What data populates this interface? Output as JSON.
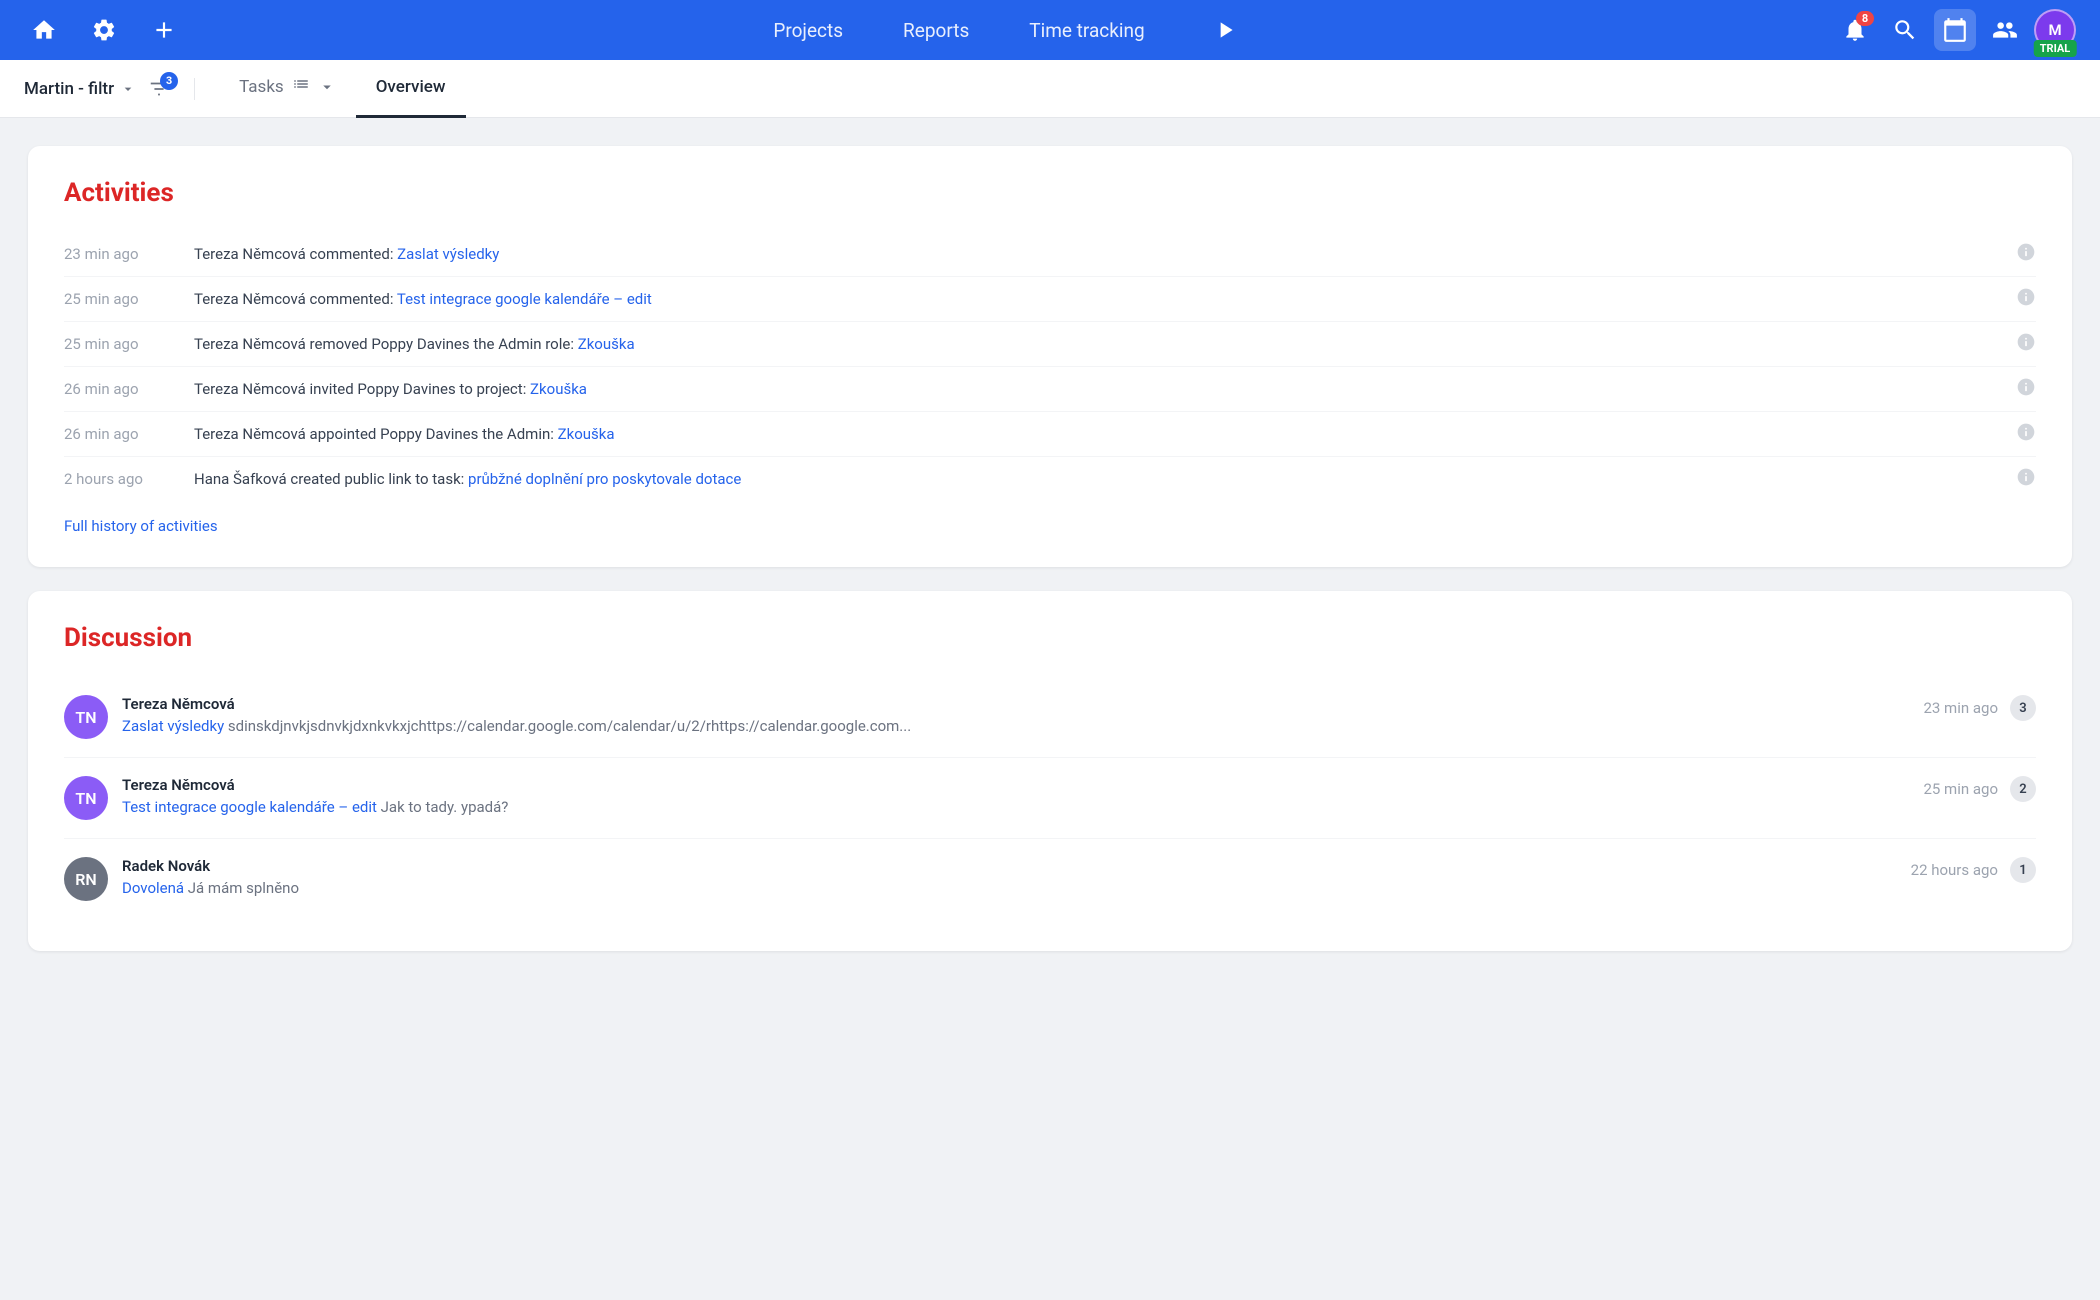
{
  "nav": {
    "projects_label": "Projects",
    "reports_label": "Reports",
    "time_tracking_label": "Time tracking",
    "notification_count": "8",
    "trial_label": "TRIAL"
  },
  "subnav": {
    "filter_label": "Martin - filtr",
    "filter_badge": "3",
    "tasks_label": "Tasks",
    "overview_label": "Overview"
  },
  "activities": {
    "title": "Activities",
    "items": [
      {
        "time": "23 min ago",
        "text_before": "Tereza Němcová commented: ",
        "link_text": "Zaslat výsledky",
        "text_after": ""
      },
      {
        "time": "25 min ago",
        "text_before": "Tereza Němcová commented: ",
        "link_text": "Test integrace google kalendáře – edit",
        "text_after": ""
      },
      {
        "time": "25 min ago",
        "text_before": "Tereza Němcová removed Poppy Davines the Admin role: ",
        "link_text": "Zkouška",
        "text_after": ""
      },
      {
        "time": "26 min ago",
        "text_before": "Tereza Němcová invited Poppy Davines to project: ",
        "link_text": "Zkouška",
        "text_after": ""
      },
      {
        "time": "26 min ago",
        "text_before": "Tereza Němcová appointed Poppy Davines the Admin: ",
        "link_text": "Zkouška",
        "text_after": ""
      },
      {
        "time": "2 hours ago",
        "text_before": "Hana Šafková created public link to task: ",
        "link_text": "průbžné doplnění pro poskytovale dotace",
        "text_after": ""
      }
    ],
    "full_history_label": "Full history of activities"
  },
  "discussion": {
    "title": "Discussion",
    "items": [
      {
        "author": "Tereza Němcová",
        "avatar_initials": "TN",
        "avatar_color": "#8b5cf6",
        "task_link": "Zaslat výsledky",
        "message": "sdinskdjnvkjsdnvkjdxnkvkxjchttps://calendar.google.com/calendar/u/2/rhttps://calendar.google.com...",
        "time": "23 min ago",
        "count": "3"
      },
      {
        "author": "Tereza Němcová",
        "avatar_initials": "TN",
        "avatar_color": "#8b5cf6",
        "task_link": "Test integrace google kalendáře – edit",
        "message": "Jak to tady. ypadá?",
        "time": "25 min ago",
        "count": "2"
      },
      {
        "author": "Radek Novák",
        "avatar_initials": "RN",
        "avatar_color": "#6b7280",
        "task_link": "Dovolená",
        "message": "Já mám splněno",
        "time": "22 hours ago",
        "count": "1"
      }
    ]
  }
}
